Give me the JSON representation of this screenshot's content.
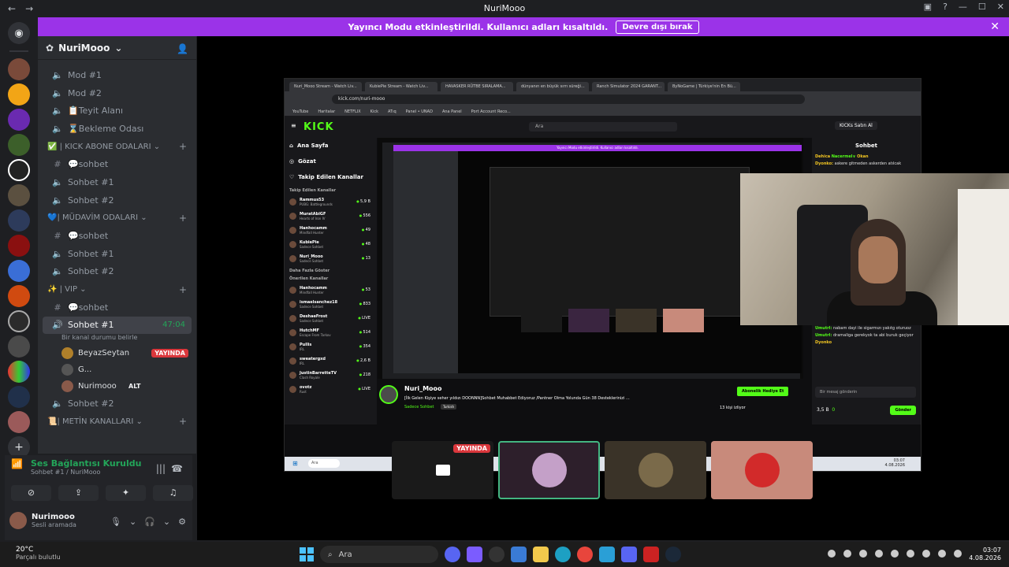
{
  "window": {
    "title": "NuriMooo",
    "back": "←",
    "forward": "→"
  },
  "banner": {
    "text": "Yayıncı Modu etkinleştirildi. Kullanıcı adları kısaltıldı.",
    "button": "Devre dışı bırak"
  },
  "server": {
    "name": "NuriMooo"
  },
  "channels": [
    {
      "type": "voice",
      "name": "Mod #1"
    },
    {
      "type": "voice",
      "name": "Mod #2"
    },
    {
      "type": "voice",
      "name": "📋Teyit Alanı"
    },
    {
      "type": "voice",
      "name": "⌛Bekleme Odası"
    }
  ],
  "categories": {
    "kick": {
      "label": "✅ | KICK ABONE ODALARI",
      "items": [
        {
          "type": "text",
          "name": "💬sohbet"
        },
        {
          "type": "voice",
          "name": "Sohbet #1"
        },
        {
          "type": "voice",
          "name": "Sohbet #2"
        }
      ]
    },
    "mudavim": {
      "label": "💙| MÜDAVİM ODALARI",
      "items": [
        {
          "type": "text",
          "name": "💬sohbet"
        },
        {
          "type": "voice",
          "name": "Sohbet #1"
        },
        {
          "type": "voice",
          "name": "Sohbet #2"
        }
      ]
    },
    "vip": {
      "label": "✨ | VIP",
      "items": [
        {
          "type": "text",
          "name": "💬sohbet"
        }
      ]
    },
    "active_channel": {
      "name": "Sohbet #1",
      "timer": "47:04",
      "status": "Bir kanal durumu belirle"
    },
    "vip_users": [
      {
        "name": "BeyazSeytan",
        "badge": "YAYINDA"
      },
      {
        "name": "G..."
      },
      {
        "name": "Nurimooo",
        "badge": "ALT"
      }
    ],
    "vip_after": {
      "name": "Sohbet #2"
    },
    "metin": {
      "label": "📜| METİN KANALLARI"
    }
  },
  "voice_panel": {
    "status": "Ses Bağlantısı Kuruldu",
    "channel": "Sohbet #1 / NuriMooo",
    "user": "Nurimooo",
    "user_status": "Sesli aramada"
  },
  "screen": {
    "tabs": [
      "Nuri_Mooo Stream - Watch Liv...",
      "KubiePie Stream - Watch Liv...",
      "HAVASKER RÜTBE SIRALAMA...",
      "dünyanın en büyük sırrı süreği...",
      "Ranch Simulator 2024 GARANT...",
      "ByNoGame | Türkiye'nin En Bü..."
    ],
    "url": "kick.com/nuri-mooo",
    "bookmarks": [
      "YouTube",
      "Haritalar",
      "NETFLIX",
      "Kick",
      "ATıq",
      "Panel • UNAD",
      "Ana Panel",
      "Port Account Reco..."
    ],
    "kick_logo": "KICK",
    "search": "Ara",
    "buy": "KICKs Satın Al",
    "nav": [
      "Ana Sayfa",
      "Gözat",
      "Takip Edilen Kanallar"
    ],
    "followed_label": "Takip Edilen Kanallar",
    "followed": [
      {
        "name": "Rammus53",
        "cat": "PUBG: Battlegrounds",
        "count": "5,9 B"
      },
      {
        "name": "MuratAbiGF",
        "cat": "Hearts of Iron IV",
        "count": "556"
      },
      {
        "name": "Hanhocamm",
        "cat": "Mindfall Hunter",
        "count": "49"
      },
      {
        "name": "KubiePie",
        "cat": "Sadece Sohbet",
        "count": "48"
      },
      {
        "name": "Nuri_Mooo",
        "cat": "Sadece Sohbet",
        "count": "13"
      }
    ],
    "more": "Daha Fazla Göster",
    "recommended_label": "Önerilen Kanallar",
    "recommended": [
      {
        "name": "Hanhocamm",
        "cat": "Mindfall Hunter",
        "count": "53"
      },
      {
        "name": "ismaelsanchez18",
        "cat": "Sadece Sohbet",
        "count": "833"
      },
      {
        "name": "DeshaeFrost",
        "cat": "Sadece Sohbet",
        "count": "LIVE"
      },
      {
        "name": "HutchMF",
        "cat": "Escape From Tarkov",
        "count": "514"
      },
      {
        "name": "Pullis",
        "cat": "IRL",
        "count": "354"
      },
      {
        "name": "sweatergxd",
        "cat": "IRL",
        "count": "2,6 B"
      },
      {
        "name": "JustinBarrettеTV",
        "cat": "Clash Royale",
        "count": "218"
      },
      {
        "name": "ovotz",
        "cat": "Rust",
        "count": "LIVE"
      }
    ],
    "chat_title": "Sohbet",
    "chat": [
      {
        "user": "Dehica",
        "text": "",
        "u2": "Nacermel∨",
        "u3": "Okan"
      },
      {
        "user": "Dyonko:",
        "text": "askere gitmeden askerden atılcak"
      },
      {
        "user": "Umutrl:",
        "text": "nabam dayi ile sigarmızı yakıtg oturuoz"
      },
      {
        "user": "Umutrl:",
        "text": "dramaliga gerekyok ta abi buruk geçiyor"
      },
      {
        "user": "Dyonko",
        "text": ""
      }
    ],
    "chat_placeholder": "Bir mesaj gönderin",
    "chat_points": "3,5 B",
    "chat_zero": "0",
    "chat_send": "Gönder",
    "streamer": "Nuri_Mooo",
    "stream_title": "[İlk Gelen Kişiye seher yıldızı DOONNN]Sohbet Muhabbet Ediyoruz /Pantner Olma Yolunda Gün 38 Desteklerinizi ...",
    "stream_cat": "Sadece Sohbet",
    "stream_tag": "Turkish",
    "gift": "Abonelik Hediye Et",
    "viewers": "13 kişi izliyor",
    "nested_banner": "Yayıncı Modu etkinleştirildi. Kullanıcı adları kısaltıldı.",
    "taskbar_search": "Ara",
    "time": "03:07",
    "date": "4.08.2026"
  },
  "tiles": [
    {
      "badge": "YAYINDA"
    }
  ],
  "taskbar": {
    "temp": "20°C",
    "cond": "Parçalı bulutlu",
    "search": "Ara",
    "time": "03:07",
    "date": "4.08.2026"
  },
  "colors": {
    "discord_bg": "#1e1f22",
    "sidebar": "#2b2d31",
    "banner": "#9b33e8",
    "kick_green": "#53fc18",
    "live_red": "#da373c"
  }
}
